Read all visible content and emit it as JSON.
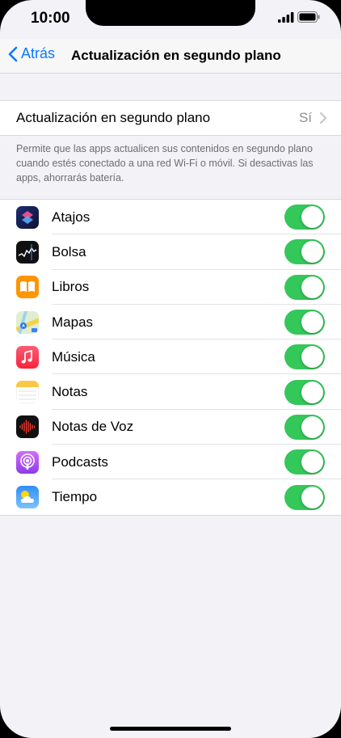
{
  "status": {
    "time": "10:00",
    "signal_icon": "cellular-signal-icon",
    "battery_icon": "battery-icon"
  },
  "nav": {
    "back_label": "Atrás",
    "title": "Actualización en segundo plano"
  },
  "main_setting": {
    "label": "Actualización en segundo plano",
    "value": "Sí"
  },
  "footer_text": "Permite que las apps actualicen sus contenidos en segundo plano cuando estés conectado a una red Wi‑Fi o móvil. Si desactivas las apps, ahorrarás batería.",
  "apps": [
    {
      "label": "Atajos",
      "icon": "shortcuts-icon",
      "enabled": true
    },
    {
      "label": "Bolsa",
      "icon": "stocks-icon",
      "enabled": true
    },
    {
      "label": "Libros",
      "icon": "books-icon",
      "enabled": true
    },
    {
      "label": "Mapas",
      "icon": "maps-icon",
      "enabled": true
    },
    {
      "label": "Música",
      "icon": "music-icon",
      "enabled": true
    },
    {
      "label": "Notas",
      "icon": "notes-icon",
      "enabled": true
    },
    {
      "label": "Notas de Voz",
      "icon": "voice-memos-icon",
      "enabled": true
    },
    {
      "label": "Podcasts",
      "icon": "podcasts-icon",
      "enabled": true
    },
    {
      "label": "Tiempo",
      "icon": "weather-icon",
      "enabled": true
    }
  ],
  "colors": {
    "accent": "#0a7aff",
    "toggle_on": "#34c759",
    "background": "#f2f2f7"
  }
}
